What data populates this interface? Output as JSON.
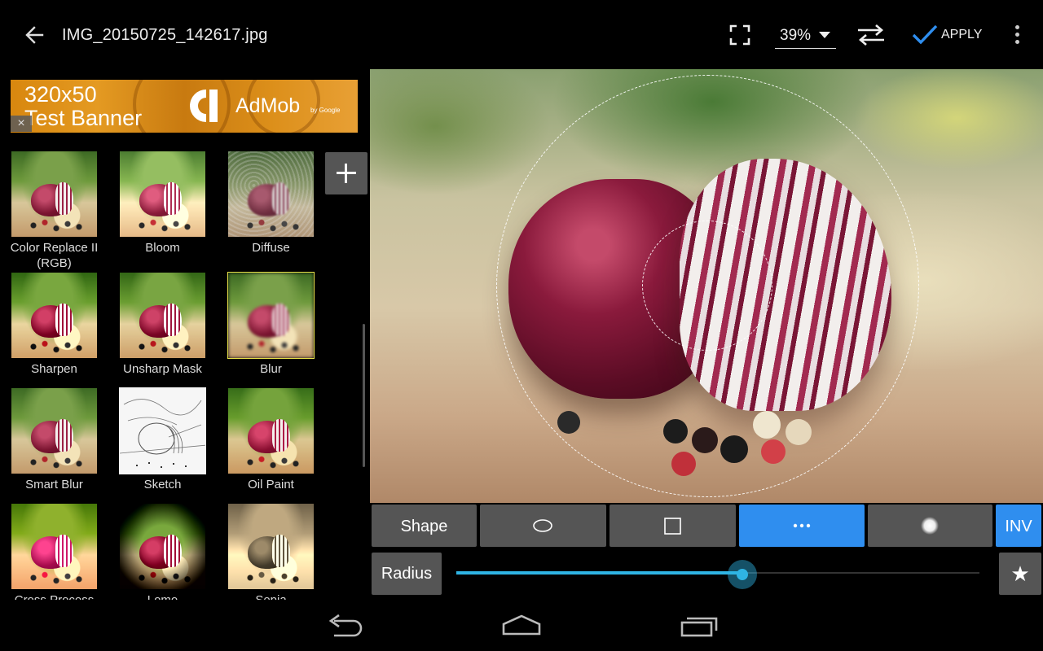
{
  "topbar": {
    "file_name": "IMG_20150725_142617.jpg",
    "zoom_value": "39%",
    "apply_label": "APPLY"
  },
  "ad": {
    "size_text": "320x50",
    "test_text": "Test Banner",
    "brand": "AdMob",
    "by_line": "by Google",
    "close_glyph": "×"
  },
  "effects": [
    {
      "label": "Color Replace II (RGB)",
      "selected": false,
      "style": "normal"
    },
    {
      "label": "Bloom",
      "selected": false,
      "style": "bright"
    },
    {
      "label": "Diffuse",
      "selected": false,
      "style": "diffuse"
    },
    {
      "label": "Sharpen",
      "selected": false,
      "style": "normal"
    },
    {
      "label": "Unsharp Mask",
      "selected": false,
      "style": "normal"
    },
    {
      "label": "Blur",
      "selected": true,
      "style": "blur"
    },
    {
      "label": "Smart Blur",
      "selected": false,
      "style": "normal"
    },
    {
      "label": "Sketch",
      "selected": false,
      "style": "sketch"
    },
    {
      "label": "Oil Paint",
      "selected": false,
      "style": "normal"
    },
    {
      "label": "Cross Process",
      "selected": false,
      "style": "bright"
    },
    {
      "label": "Lomo",
      "selected": false,
      "style": "lomo"
    },
    {
      "label": "Sepia",
      "selected": false,
      "style": "sepia"
    }
  ],
  "tools": {
    "shape_label": "Shape",
    "shape_options": [
      {
        "icon": "ellipse-icon",
        "active": false
      },
      {
        "icon": "square-icon",
        "active": false
      },
      {
        "icon": "more-dots-icon",
        "active": true
      },
      {
        "icon": "soft-circle-icon",
        "active": false
      }
    ],
    "invert_label": "INV",
    "radius_label": "Radius",
    "radius_fraction": 0.547,
    "star_glyph": "★"
  },
  "colors": {
    "accent_blue": "#2f8eef",
    "slider_blue": "#2fb4e4",
    "selected_outline": "#e8e24a",
    "button_gray": "#555555"
  }
}
